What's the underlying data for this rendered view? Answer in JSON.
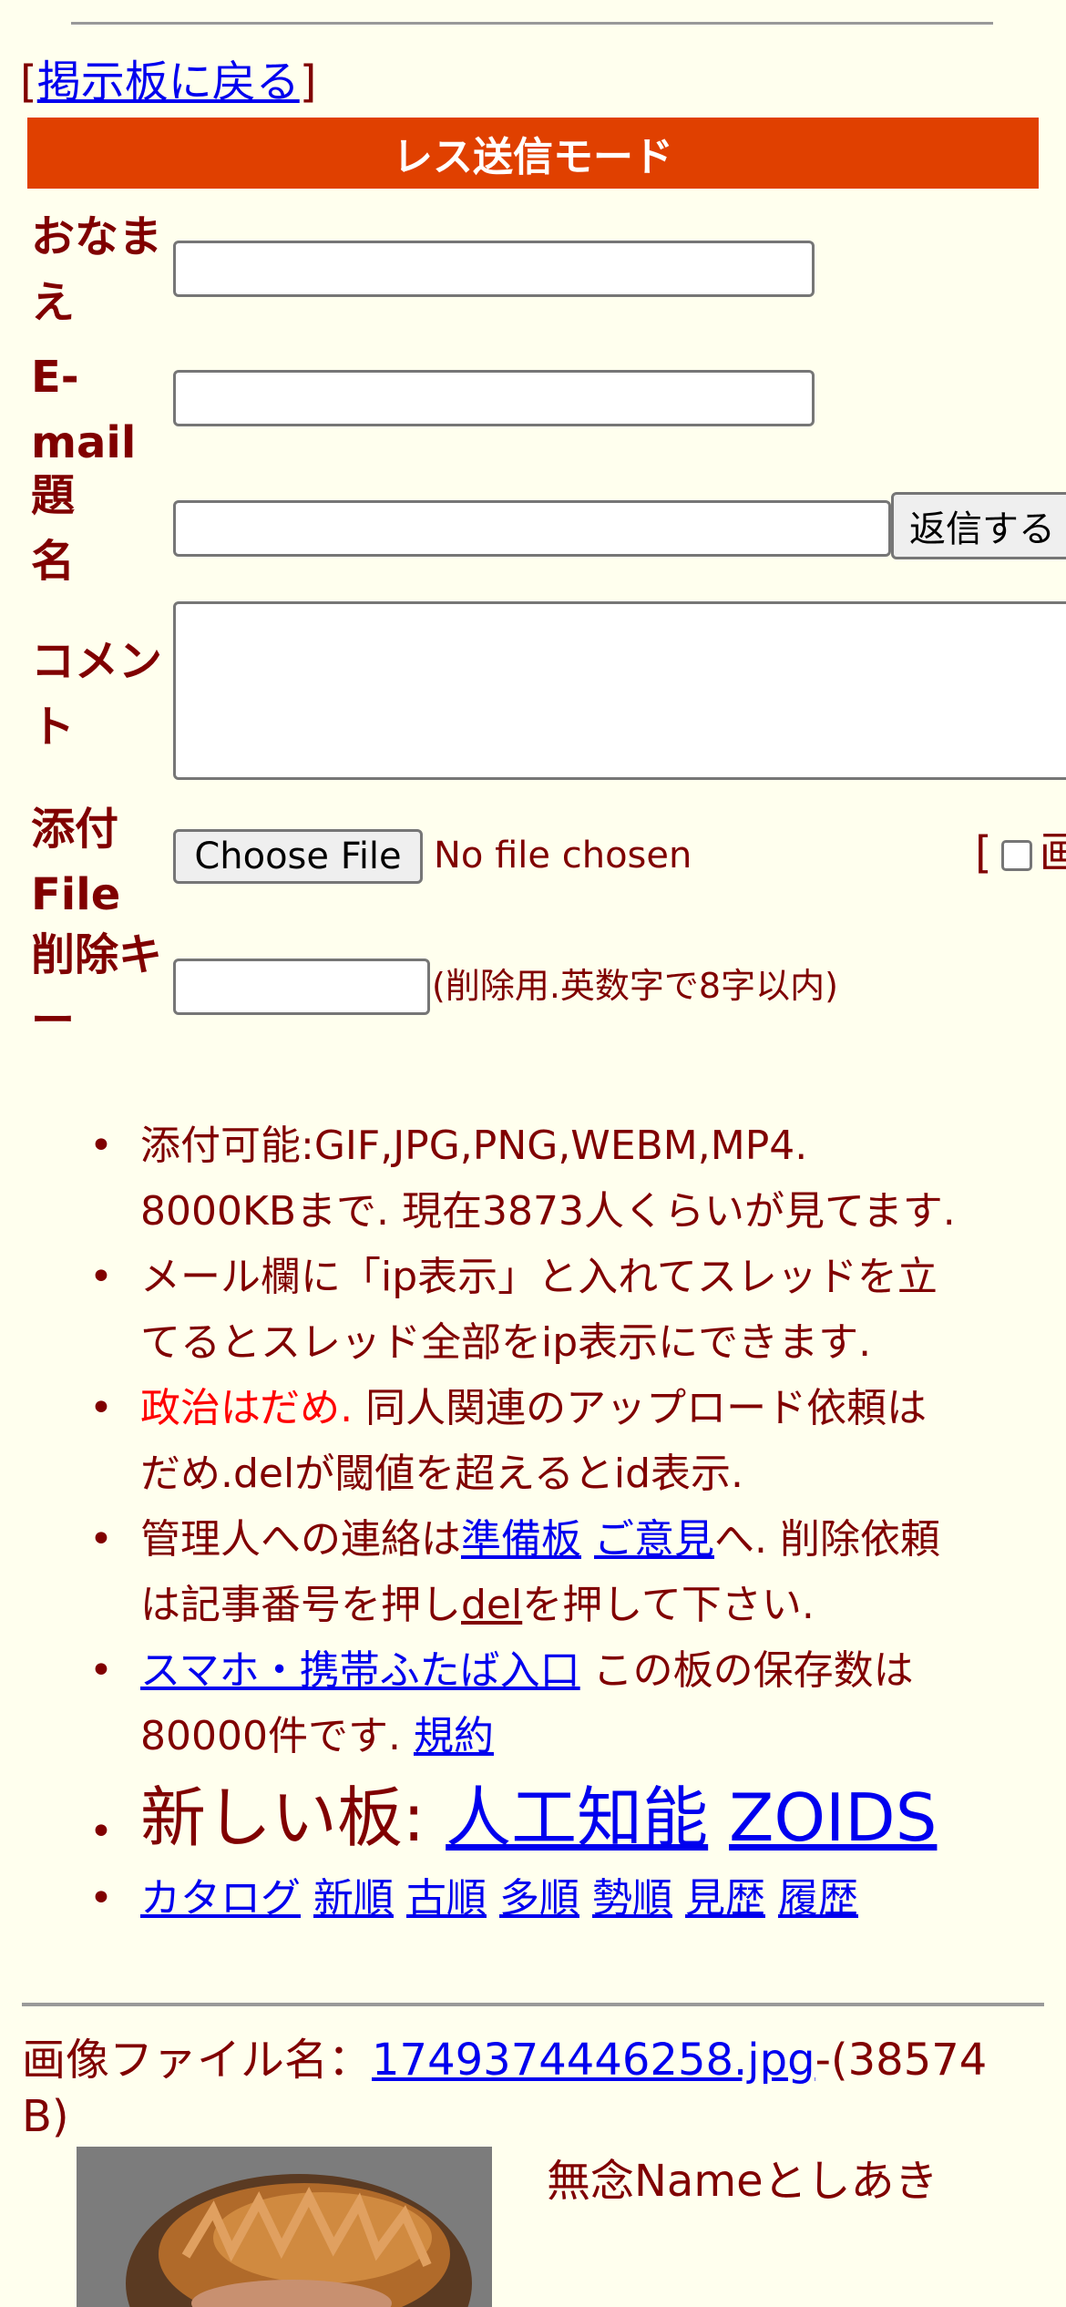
{
  "back": {
    "open": "[",
    "link": "掲示板に戻る",
    "close": "]"
  },
  "mode_bar": "レス送信モード",
  "form": {
    "name_label_1": "おなま",
    "name_label_2": "え",
    "email_label_1": "E-",
    "email_label_2": "mail",
    "subject_label_1": "題",
    "subject_label_2": "名",
    "submit_label": "返信する",
    "comment_label_1": "コメン",
    "comment_label_2": "ト",
    "attach_label_1": "添付",
    "attach_label_2": "File",
    "choose_file": "Choose File",
    "no_file": "No file chosen",
    "bracket": "[",
    "bracket_glyph": "画",
    "delkey_label_1": "削除キ",
    "delkey_label_2": "ー",
    "delkey_note": "(削除用.英数字で8字以内)"
  },
  "rules": {
    "r1_a": "添付可能:GIF,JPG,PNG,WEBM,MP4.",
    "r1_b": "8000KBまで. 現在3873人くらいが見てます.",
    "r2_a": "メール欄に「ip表示」と入れてスレッドを立",
    "r2_b": "てるとスレッド全部をip表示にできます.",
    "r3_red": "政治はだめ.",
    "r3_a": " 同人関連のアップロード依頼は",
    "r3_b": "だめ.delが閾値を超えるとid表示.",
    "r4_a": "管理人への連絡は",
    "r4_link1": "準備板",
    "r4_link2": "ご意見",
    "r4_b": "へ. 削除依頼",
    "r4_c": "は記事番号を押し",
    "r4_del": "del",
    "r4_d": "を押して下さい.",
    "r5_link": "スマホ・携帯ふたば入口",
    "r5_a": " この板の保存数は",
    "r5_b": "80000件です.",
    "r5_terms": "規約",
    "r6_label": "新しい板: ",
    "r6_link1": "人工知能",
    "r6_link2": "ZOIDS",
    "nav": [
      "カタログ",
      "新順",
      "古順",
      "多順",
      "勢順",
      "見歴",
      "履歴"
    ]
  },
  "post": {
    "file_prefix": "画像ファイル名：",
    "file_name": "1749374446258.jpg",
    "file_size_a": "-(38574",
    "file_size_b": "B)",
    "poster_name": "無念Nameとしあき"
  }
}
